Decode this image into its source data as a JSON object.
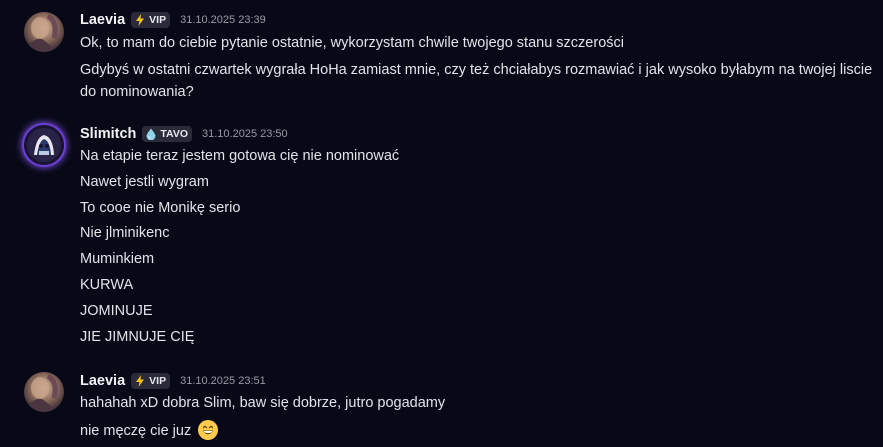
{
  "messages": [
    {
      "author": "Laevia",
      "tag": "VIP",
      "tag_icon": "lightning-icon",
      "timestamp": "31.10.2025 23:39",
      "lines": [
        "Ok, to mam do ciebie pytanie ostatnie, wykorzystam chwile twojego stanu szczerości",
        "Gdybyś w ostatni czwartek wygrała HoHa zamiast mnie, czy też chciałabys rozmawiać i jak wysoko byłabym na twojej liscie do nominowania?"
      ]
    },
    {
      "author": "Slimitch",
      "tag": "TAVO",
      "tag_icon": "droplet-icon",
      "timestamp": "31.10.2025 23:50",
      "lines": [
        "Na etapie teraz jestem gotowa cię nie nominować",
        "Nawet jestli wygram",
        "To cooe nie Monikę serio",
        "Nie jlminikenc",
        "Muminkiem",
        "KURWA",
        "JOMINUJE",
        "JIE JIMNUJE CIĘ"
      ]
    },
    {
      "author": "Laevia",
      "tag": "VIP",
      "tag_icon": "lightning-icon",
      "timestamp": "31.10.2025 23:51",
      "lines": [
        "hahahah xD dobra Slim, baw się dobrze, jutro pogadamy",
        "nie męczę cie juz"
      ],
      "trailing_emoji": "grinning-face-emoji"
    }
  ],
  "colors": {
    "background": "#080816",
    "username": "#f2f2f5",
    "text": "#e3e3ea",
    "timestamp": "#9a9aa6",
    "tag_bg": "#2a2a38",
    "vip_icon": "#f5c518",
    "tavo_icon": "#8fd3e8"
  }
}
